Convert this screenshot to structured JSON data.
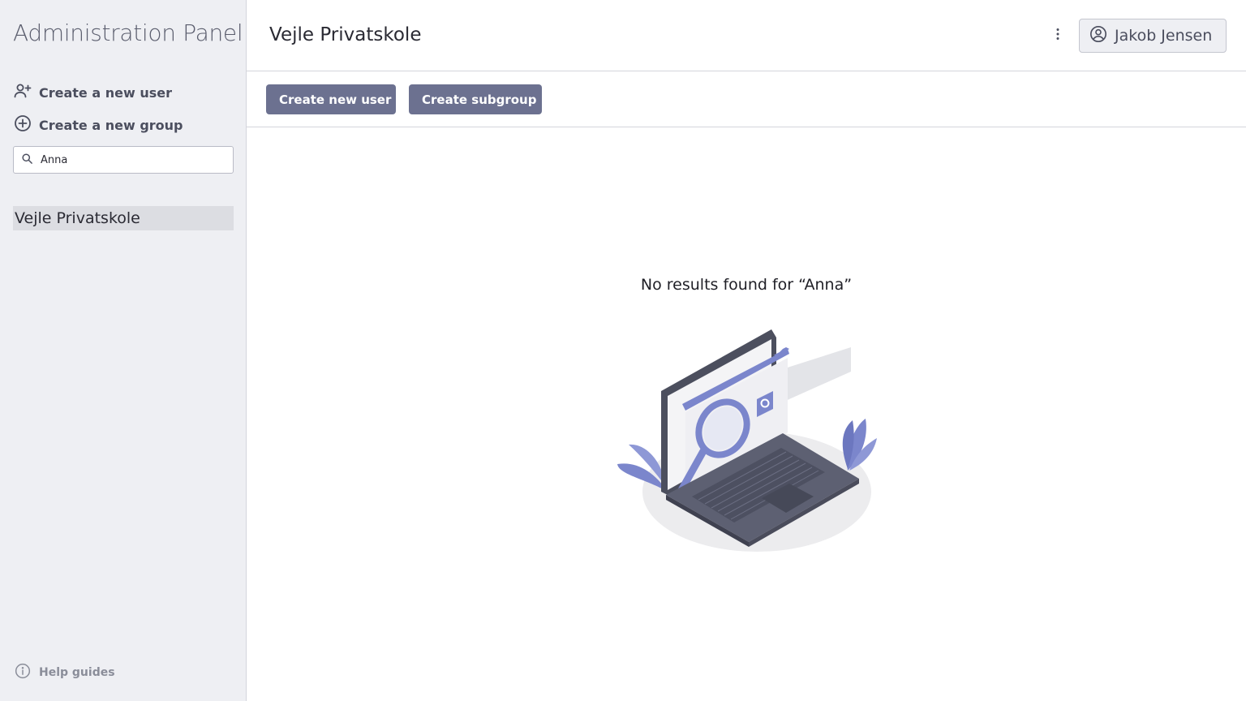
{
  "sidebar": {
    "app_title": "Administration Panel",
    "create_user_label": "Create a new user",
    "create_group_label": "Create a new group",
    "search": {
      "value": "Anna",
      "placeholder": ""
    },
    "tree_items": [
      "Vejle Privatskole"
    ],
    "help_label": "Help guides"
  },
  "header": {
    "title": "Vejle Privatskole",
    "user_name": "Jakob Jensen"
  },
  "toolbar": {
    "create_user_button": "Create new user",
    "create_subgroup_button": "Create subgroup"
  },
  "main": {
    "empty_message": "No results found for “Anna”"
  },
  "icons": {
    "create_user": "user-plus-icon",
    "create_group": "plus-circle-icon",
    "search": "search-icon",
    "help": "info-icon",
    "more": "more-vertical-icon",
    "account": "account-circle-icon"
  },
  "colors": {
    "accent": "#6c7190",
    "illustration_accent": "#7b86cc",
    "sidebar_bg": "#eeeff3"
  }
}
